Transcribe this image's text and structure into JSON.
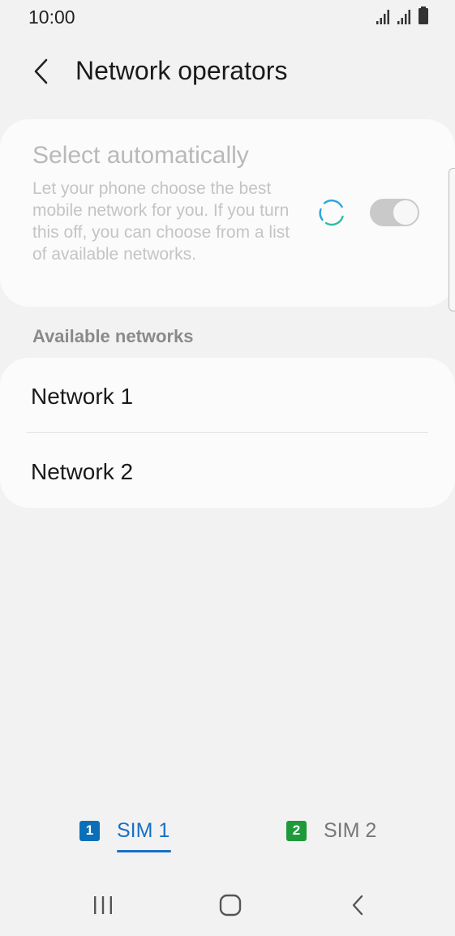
{
  "status_bar": {
    "time": "10:00",
    "icons": [
      "signal-sim1-icon",
      "signal-sim2-icon",
      "battery-icon"
    ]
  },
  "app_bar": {
    "back_icon": "chevron-left-icon",
    "title": "Network operators"
  },
  "auto_select": {
    "title": "Select automatically",
    "description": "Let your phone choose the best mobile network for you. If you turn this off, you can choose from a list of available networks.",
    "toggle_on": true,
    "loading": true
  },
  "available": {
    "header": "Available networks",
    "networks": [
      {
        "label": "Network 1"
      },
      {
        "label": "Network 2"
      }
    ]
  },
  "sim_tabs": [
    {
      "badge": "1",
      "label": "SIM 1",
      "selected": true,
      "color": "#0a6fb8"
    },
    {
      "badge": "2",
      "label": "SIM 2",
      "selected": false,
      "color": "#1e9a3a"
    }
  ],
  "nav_bar": {
    "icons": [
      "recents-icon",
      "home-icon",
      "back-icon"
    ]
  },
  "colors": {
    "accent": "#1a6fc4",
    "background": "#f2f2f2",
    "card": "#fbfbfb",
    "spinner_a": "#2aa6e0",
    "spinner_b": "#2bbf9f"
  }
}
